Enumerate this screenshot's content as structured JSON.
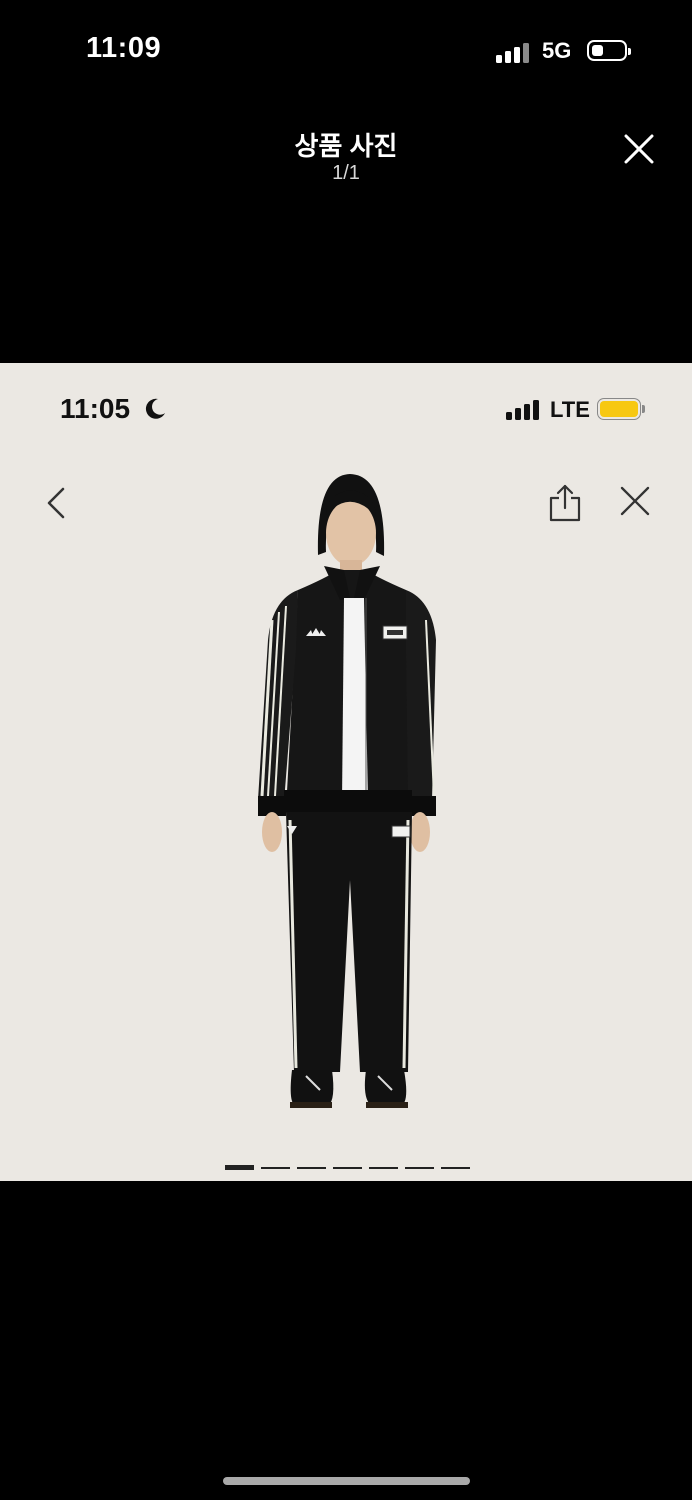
{
  "status_bar": {
    "time": "11:09",
    "network": "5G"
  },
  "viewer": {
    "title": "상품 사진",
    "counter": "1/1",
    "close_icon": "close-icon"
  },
  "photo": {
    "status_bar": {
      "time": "11:05",
      "network": "LTE",
      "battery_color": "#f7c812"
    },
    "nav": {
      "back_icon": "chevron-left-icon",
      "share_icon": "share-icon",
      "close_icon": "close-icon"
    },
    "carousel": {
      "total": 7,
      "current": 1
    },
    "background": "#ebe8e3"
  }
}
